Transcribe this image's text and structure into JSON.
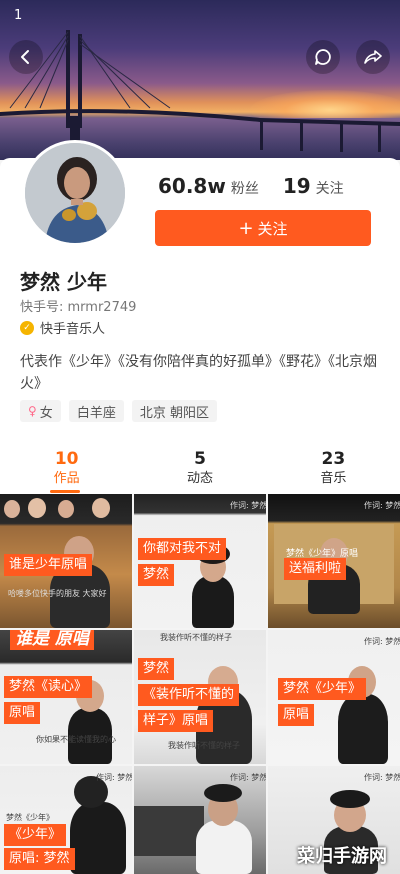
{
  "status_bar": {
    "text": "1"
  },
  "profile": {
    "name": "梦然 少年",
    "kuaishou_id": "快手号: mrmr2749",
    "verification": "快手音乐人",
    "bio": "代表作《少年》《没有你陪伴真的好孤单》《野花》《北京烟火》",
    "fans_count": "60.8w",
    "fans_label": "粉丝",
    "following_count": "19",
    "following_label": "关注",
    "follow_button": "关注",
    "tags": [
      "女",
      "白羊座",
      "北京 朝阳区"
    ]
  },
  "tabs": [
    {
      "count": "10",
      "label": "作品",
      "active": true
    },
    {
      "count": "5",
      "label": "动态",
      "active": false
    },
    {
      "count": "23",
      "label": "音乐",
      "active": false
    }
  ],
  "videos": [
    {
      "caption": "谁是少年原唱",
      "subtitle": "哈喽多位快手的朋友 大家好"
    },
    {
      "caption": "你都对我不对",
      "caption2": "梦然",
      "credit": "作词: 梦然"
    },
    {
      "caption": "送福利啦",
      "caption_small": "梦然《少年》原唱",
      "credit": "作词: 梦然"
    },
    {
      "caption": "梦然《读心》",
      "caption2": "原唱",
      "subtitle": "你如果不能读懂我的心",
      "overlay_text": "谁是 原唱"
    },
    {
      "caption": "梦然",
      "caption2": "《装作听不懂的",
      "caption3": "样子》原唱",
      "subtitle": "我装作听不懂的样子",
      "overlay_text": "我装作听不懂的样子"
    },
    {
      "caption": "梦然《少年》",
      "caption2": "原唱",
      "credit": "作词: 梦然"
    },
    {
      "caption": "梦然《少年》",
      "caption2": "《少年》",
      "caption3": "原唱: 梦然",
      "credit": "作词: 梦然"
    },
    {
      "credit": "作词: 梦然"
    },
    {
      "credit": "作词: 梦然"
    }
  ],
  "watermark": "菜归手游网",
  "colors": {
    "accent": "#ff5a1f",
    "tab_active": "#ff6a10"
  }
}
